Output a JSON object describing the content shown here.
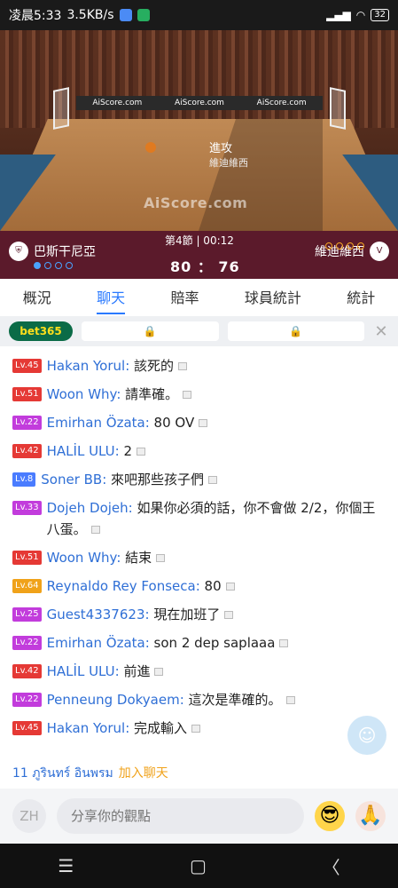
{
  "status": {
    "time": "凌晨5:33",
    "speed": "3.5KB/s",
    "battery": "32"
  },
  "court": {
    "ads": [
      "AiScore.com",
      "AiScore.com",
      "AiScore.com"
    ],
    "watermark": "AiScore.com",
    "attack_label": "進攻",
    "attack_team": "維迪維西"
  },
  "scoreboard": {
    "period": "第4節 | 00:12",
    "home_team": "巴斯干尼亞",
    "away_team": "維迪維西",
    "score": "80 ： 76",
    "home_timeouts_used": 1,
    "away_timeouts_used": 0
  },
  "tabs": [
    "概況",
    "聊天",
    "賠率",
    "球員統計",
    "統計"
  ],
  "active_tab": "聊天",
  "betting": {
    "brand": "bet365",
    "slot_icon": "lock-icon",
    "close": "✕"
  },
  "chat": [
    {
      "level": "Lv.45",
      "color": "red",
      "user": "Hakan Yorul",
      "text": "該死的"
    },
    {
      "level": "Lv.51",
      "color": "red",
      "user": "Woon Why",
      "text": "請準確。"
    },
    {
      "level": "Lv.22",
      "color": "purple",
      "user": "Emirhan Özata",
      "text": "80 OV"
    },
    {
      "level": "Lv.42",
      "color": "red",
      "user": "HALİL ULU",
      "text": "2"
    },
    {
      "level": "Lv.8",
      "color": "blue",
      "user": "Soner BB",
      "text": "來吧那些孩子們"
    },
    {
      "level": "Lv.33",
      "color": "purple",
      "user": "Dojeh Dojeh",
      "text": "如果你必須的話，你不會做 2/2，你個王八蛋。"
    },
    {
      "level": "Lv.51",
      "color": "red",
      "user": "Woon Why",
      "text": "結束"
    },
    {
      "level": "Lv.64",
      "color": "orange",
      "user": "Reynaldo Rey Fonseca",
      "text": "80"
    },
    {
      "level": "Lv.25",
      "color": "purple",
      "user": "Guest4337623",
      "text": "現在加班了"
    },
    {
      "level": "Lv.22",
      "color": "purple",
      "user": "Emirhan Özata",
      "text": "son 2 dep saplaaa"
    },
    {
      "level": "Lv.42",
      "color": "red",
      "user": "HALİL ULU",
      "text": "前進"
    },
    {
      "level": "Lv.22",
      "color": "purple",
      "user": "Penneung Dokyaem",
      "text": "這次是準確的。"
    },
    {
      "level": "Lv.45",
      "color": "red",
      "user": "Hakan Yorul",
      "text": "完成輸入"
    }
  ],
  "online": {
    "text": "11 ภูรินทร์ อินพรม",
    "join": "加入聊天"
  },
  "input": {
    "lang": "ZH",
    "placeholder": "分享你的觀點"
  },
  "nav": {
    "menu": "☰",
    "home": "▢",
    "back": "〈"
  }
}
